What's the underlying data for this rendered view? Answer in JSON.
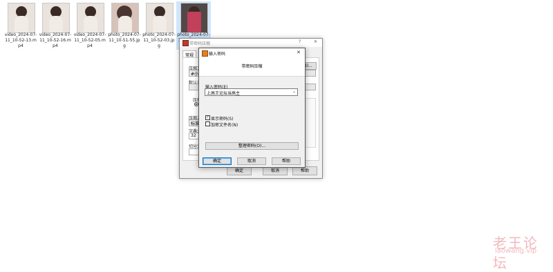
{
  "files": [
    {
      "name": "video_2024-07-11_10-52-13.mp4",
      "thumb": "portrait"
    },
    {
      "name": "video_2024-07-11_10-52-16.mp4",
      "thumb": "portrait"
    },
    {
      "name": "video_2024-07-11_10-52-05.mp4",
      "thumb": "portrait"
    },
    {
      "name": "photo_2024-07-11_10-51-55.jpg",
      "thumb": "wide"
    },
    {
      "name": "photo_2024-07-11_10-52-03.jpg",
      "thumb": "portrait"
    },
    {
      "name": "photo_2024-07-11_10-52-09.jpg",
      "thumb": "phone"
    }
  ],
  "back_dialog": {
    "title": "带密码压缩",
    "help_glyph": "?",
    "close_glyph": "✕",
    "tab": "常规",
    "labels": {
      "archive_name": "压缩文",
      "archive_value": "#小高",
      "profile": "默认设",
      "format": "压缩",
      "method": "压缩方",
      "method_value": "标准",
      "dict": "字典大",
      "dict_value": "32",
      "split": "切分为"
    },
    "browse_btn": "览(B)...",
    "buttons": {
      "ok": "确定",
      "cancel": "取消",
      "help": "帮助"
    }
  },
  "password_dialog": {
    "title": "输入密码",
    "close_glyph": "✕",
    "header": "带密码压缩",
    "password_label": "输入密码(E)",
    "password_value": "上高王论坛当高主",
    "show_password": {
      "label": "显示密码(S)",
      "checked": true
    },
    "encrypt_filenames": {
      "label": "加密文件名(N)",
      "checked": false
    },
    "manage_btn": "整理密码(O)...",
    "buttons": {
      "ok": "确定",
      "cancel": "取消",
      "help": "帮助"
    }
  },
  "watermark": {
    "line1": "老王论坛",
    "line2": "laowang.vip"
  }
}
